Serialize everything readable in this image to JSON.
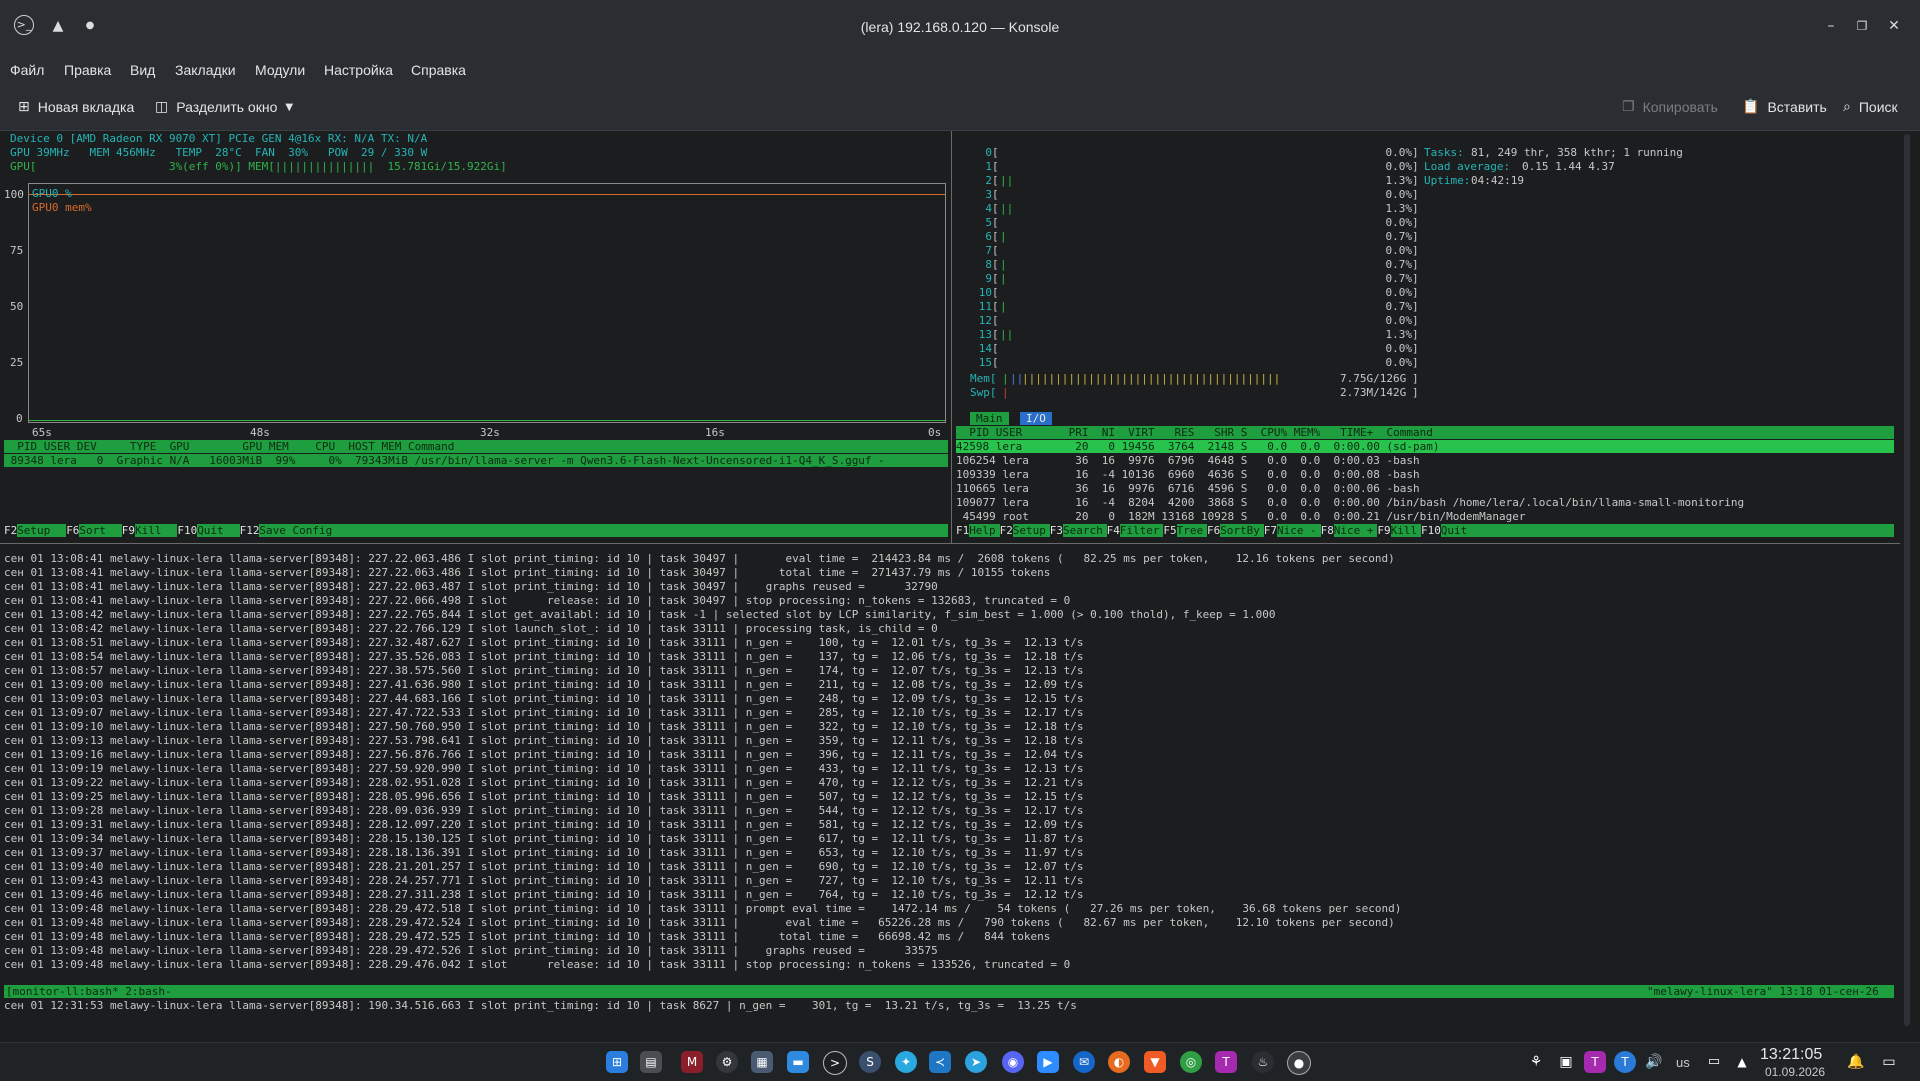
{
  "window": {
    "title": "(lera) 192.168.0.120 — Konsole"
  },
  "menu": [
    "Файл",
    "Правка",
    "Вид",
    "Закладки",
    "Модули",
    "Настройка",
    "Справка"
  ],
  "toolbar": {
    "new_tab": "Новая вкладка",
    "split": "Разделить окно",
    "copy": "Копировать",
    "paste": "Вставить",
    "search": "Поиск"
  },
  "nvtop": {
    "line1": "Device 0 [AMD Radeon RX 9070 XT] PCIe GEN 4@16x RX: N/A TX: N/A",
    "line2": "GPU 39MHz   MEM 456MHz   TEMP  28°C  FAN  30%   POW  29 / 330 W",
    "line3": "GPU[                    3%(eff 0%)] MEM[|||||||||||||||  15.781Gi/15.922Gi]",
    "yticks": [
      "100",
      "75",
      "50",
      "25",
      "0"
    ],
    "xticks": [
      "65s",
      "48s",
      "32s",
      "16s",
      "0s"
    ],
    "legend_gpu": "GPU0 %",
    "legend_mem": "GPU0 mem%",
    "proc_header": "  PID USER DEV     TYPE  GPU        GPU MEM    CPU  HOST MEM Command",
    "proc_row": " 89348 lera   0  Graphic N/A   16003MiB  99%     0%  79343MiB /usr/bin/llama-server -m Qwen3.6-Flash-Next-Uncensored-i1-Q4_K_S.gguf -",
    "fkeys": [
      [
        "F2",
        "Setup"
      ],
      [
        "F6",
        "Sort"
      ],
      [
        "F9",
        "Kill"
      ],
      [
        "F10",
        "Quit"
      ],
      [
        "F12",
        "Save Config"
      ]
    ]
  },
  "htop": {
    "cpus": [
      [
        "0",
        "0.0%"
      ],
      [
        "1",
        "0.0%"
      ],
      [
        "2",
        "1.3%"
      ],
      [
        "3",
        "0.0%"
      ],
      [
        "4",
        "1.3%"
      ],
      [
        "5",
        "0.0%"
      ],
      [
        "6",
        "0.7%"
      ],
      [
        "7",
        "0.0%"
      ],
      [
        "8",
        "0.7%"
      ],
      [
        "9",
        "0.7%"
      ],
      [
        "10",
        "0.0%"
      ],
      [
        "11",
        "0.7%"
      ],
      [
        "12",
        "0.0%"
      ],
      [
        "13",
        "1.3%"
      ],
      [
        "14",
        "0.0%"
      ],
      [
        "15",
        "0.0%"
      ]
    ],
    "mem": "7.75G/126G",
    "swp": "2.73M/142G",
    "tasks_label": "Tasks:",
    "tasks_val": "81, 249 thr, 358 kthr; 1 running",
    "load_label": "Load average:",
    "load_val": "0.15 1.44 4.37",
    "uptime_label": "Uptime:",
    "uptime_val": "04:42:19",
    "tab_main": "Main",
    "tab_io": "I/O",
    "header": "  PID USER       PRI  NI  VIRT   RES   SHR S  CPU% MEM%   TIME+  Command",
    "rows": [
      "42598 lera        20   0 19456  3764  2148 S   0.0  0.0  0:00.00 (sd-pam)",
      "106254 lera       36  16  9976  6796  4648 S   0.0  0.0  0:00.03 -bash",
      "109339 lera       16  -4 10136  6960  4636 S   0.0  0.0  0:00.08 -bash",
      "110665 lera       36  16  9976  6716  4596 S   0.0  0.0  0:00.06 -bash",
      "109077 lera       16  -4  8204  4200  3868 S   0.0  0.0  0:00.00 /bin/bash /home/lera/.local/bin/llama-small-monitoring",
      " 45499 root       20   0  182M 13168 10928 S   0.0  0.0  0:00.21 /usr/bin/ModemManager"
    ],
    "fkeys": [
      [
        "F1",
        "Help"
      ],
      [
        "F2",
        "Setup"
      ],
      [
        "F3",
        "Search"
      ],
      [
        "F4",
        "Filter"
      ],
      [
        "F5",
        "Tree"
      ],
      [
        "F6",
        "SortBy"
      ],
      [
        "F7",
        "Nice -"
      ],
      [
        "F8",
        "Nice +"
      ],
      [
        "F9",
        "Kill"
      ],
      [
        "F10",
        "Quit"
      ]
    ]
  },
  "log": [
    "сен 01 13:08:41 melawy-linux-lera llama-server[89348]: 227.22.063.486 I slot print_timing: id 10 | task 30497 |       eval time =  214423.84 ms /  2608 tokens (   82.25 ms per token,    12.16 tokens per second)",
    "сен 01 13:08:41 melawy-linux-lera llama-server[89348]: 227.22.063.486 I slot print_timing: id 10 | task 30497 |      total time =  271437.79 ms / 10155 tokens",
    "сен 01 13:08:41 melawy-linux-lera llama-server[89348]: 227.22.063.487 I slot print_timing: id 10 | task 30497 |    graphs reused =      32790",
    "сен 01 13:08:41 melawy-linux-lera llama-server[89348]: 227.22.066.498 I slot      release: id 10 | task 30497 | stop processing: n_tokens = 132683, truncated = 0",
    "сен 01 13:08:42 melawy-linux-lera llama-server[89348]: 227.22.765.844 I slot get_availabl: id 10 | task -1 | selected slot by LCP similarity, f_sim_best = 1.000 (> 0.100 thold), f_keep = 1.000",
    "сен 01 13:08:42 melawy-linux-lera llama-server[89348]: 227.22.766.129 I slot launch_slot_: id 10 | task 33111 | processing task, is_child = 0",
    "сен 01 13:08:51 melawy-linux-lera llama-server[89348]: 227.32.487.627 I slot print_timing: id 10 | task 33111 | n_gen =    100, tg =  12.01 t/s, tg_3s =  12.13 t/s",
    "сен 01 13:08:54 melawy-linux-lera llama-server[89348]: 227.35.526.083 I slot print_timing: id 10 | task 33111 | n_gen =    137, tg =  12.06 t/s, tg_3s =  12.18 t/s",
    "сен 01 13:08:57 melawy-linux-lera llama-server[89348]: 227.38.575.560 I slot print_timing: id 10 | task 33111 | n_gen =    174, tg =  12.07 t/s, tg_3s =  12.13 t/s",
    "сен 01 13:09:00 melawy-linux-lera llama-server[89348]: 227.41.636.980 I slot print_timing: id 10 | task 33111 | n_gen =    211, tg =  12.08 t/s, tg_3s =  12.09 t/s",
    "сен 01 13:09:03 melawy-linux-lera llama-server[89348]: 227.44.683.166 I slot print_timing: id 10 | task 33111 | n_gen =    248, tg =  12.09 t/s, tg_3s =  12.15 t/s",
    "сен 01 13:09:07 melawy-linux-lera llama-server[89348]: 227.47.722.533 I slot print_timing: id 10 | task 33111 | n_gen =    285, tg =  12.10 t/s, tg_3s =  12.17 t/s",
    "сен 01 13:09:10 melawy-linux-lera llama-server[89348]: 227.50.760.950 I slot print_timing: id 10 | task 33111 | n_gen =    322, tg =  12.10 t/s, tg_3s =  12.18 t/s",
    "сен 01 13:09:13 melawy-linux-lera llama-server[89348]: 227.53.798.641 I slot print_timing: id 10 | task 33111 | n_gen =    359, tg =  12.11 t/s, tg_3s =  12.18 t/s",
    "сен 01 13:09:16 melawy-linux-lera llama-server[89348]: 227.56.876.766 I slot print_timing: id 10 | task 33111 | n_gen =    396, tg =  12.11 t/s, tg_3s =  12.04 t/s",
    "сен 01 13:09:19 melawy-linux-lera llama-server[89348]: 227.59.920.990 I slot print_timing: id 10 | task 33111 | n_gen =    433, tg =  12.11 t/s, tg_3s =  12.13 t/s",
    "сен 01 13:09:22 melawy-linux-lera llama-server[89348]: 228.02.951.028 I slot print_timing: id 10 | task 33111 | n_gen =    470, tg =  12.12 t/s, tg_3s =  12.21 t/s",
    "сен 01 13:09:25 melawy-linux-lera llama-server[89348]: 228.05.996.656 I slot print_timing: id 10 | task 33111 | n_gen =    507, tg =  12.12 t/s, tg_3s =  12.15 t/s",
    "сен 01 13:09:28 melawy-linux-lera llama-server[89348]: 228.09.036.939 I slot print_timing: id 10 | task 33111 | n_gen =    544, tg =  12.12 t/s, tg_3s =  12.17 t/s",
    "сен 01 13:09:31 melawy-linux-lera llama-server[89348]: 228.12.097.220 I slot print_timing: id 10 | task 33111 | n_gen =    581, tg =  12.12 t/s, tg_3s =  12.09 t/s",
    "сен 01 13:09:34 melawy-linux-lera llama-server[89348]: 228.15.130.125 I slot print_timing: id 10 | task 33111 | n_gen =    617, tg =  12.11 t/s, tg_3s =  11.87 t/s",
    "сен 01 13:09:37 melawy-linux-lera llama-server[89348]: 228.18.136.391 I slot print_timing: id 10 | task 33111 | n_gen =    653, tg =  12.10 t/s, tg_3s =  11.97 t/s",
    "сен 01 13:09:40 melawy-linux-lera llama-server[89348]: 228.21.201.257 I slot print_timing: id 10 | task 33111 | n_gen =    690, tg =  12.10 t/s, tg_3s =  12.07 t/s",
    "сен 01 13:09:43 melawy-linux-lera llama-server[89348]: 228.24.257.771 I slot print_timing: id 10 | task 33111 | n_gen =    727, tg =  12.10 t/s, tg_3s =  12.11 t/s",
    "сен 01 13:09:46 melawy-linux-lera llama-server[89348]: 228.27.311.238 I slot print_timing: id 10 | task 33111 | n_gen =    764, tg =  12.10 t/s, tg_3s =  12.12 t/s",
    "сен 01 13:09:48 melawy-linux-lera llama-server[89348]: 228.29.472.518 I slot print_timing: id 10 | task 33111 | prompt eval time =    1472.14 ms /    54 tokens (   27.26 ms per token,    36.68 tokens per second)",
    "сен 01 13:09:48 melawy-linux-lera llama-server[89348]: 228.29.472.524 I slot print_timing: id 10 | task 33111 |       eval time =   65226.28 ms /   790 tokens (   82.67 ms per token,    12.10 tokens per second)",
    "сен 01 13:09:48 melawy-linux-lera llama-server[89348]: 228.29.472.525 I slot print_timing: id 10 | task 33111 |      total time =   66698.42 ms /   844 tokens",
    "сен 01 13:09:48 melawy-linux-lera llama-server[89348]: 228.29.472.526 I slot print_timing: id 10 | task 33111 |    graphs reused =      33575",
    "сен 01 13:09:48 melawy-linux-lera llama-server[89348]: 228.29.476.042 I slot      release: id 10 | task 33111 | stop processing: n_tokens = 133526, truncated = 0"
  ],
  "tmux": {
    "left": "[monitor-ll:bash* 2:bash-",
    "right": "\"melawy-linux-lera\" 13:18 01-сен-26"
  },
  "last_line": "сен 01 12:31:53 melawy-linux-lera llama-server[89348]: 190.34.516.663 I slot print_timing: id 10 | task 8627 | n_gen =    301, tg =  13.21 t/s, tg_3s =  13.25 t/s",
  "tray": {
    "layout": "us",
    "time": "13:21:05",
    "date": "01.09.2026"
  },
  "colors": {
    "green": "#1e9e3e",
    "orange": "#d86b2a",
    "cyan": "#25b5b5"
  }
}
